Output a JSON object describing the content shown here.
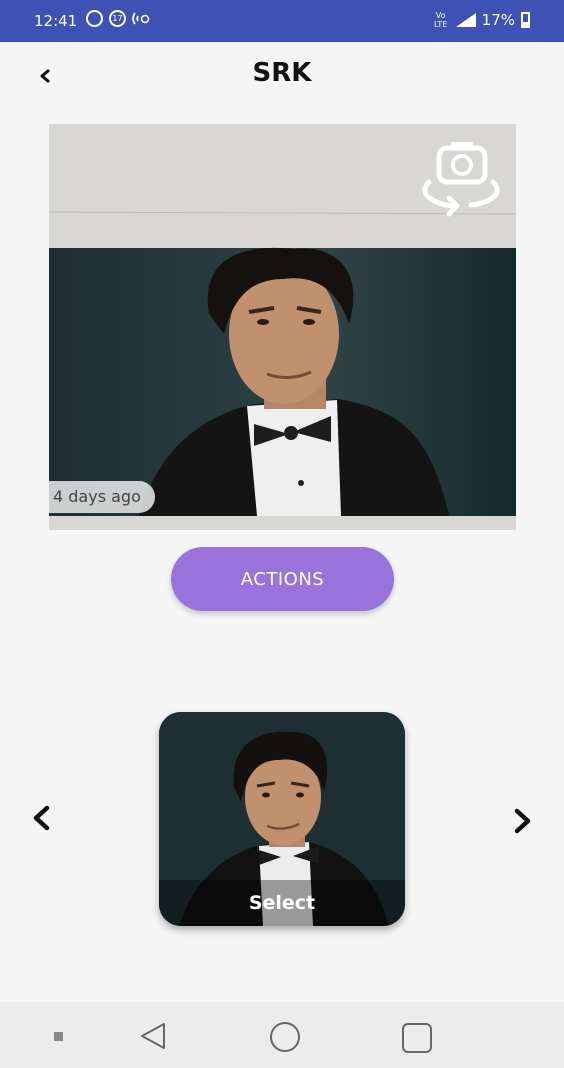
{
  "status_bar": {
    "time": "12:41",
    "network_badge": "Vo LTE",
    "battery_percent": "17%",
    "left_icons": [
      "whatsapp-icon",
      "notification-count-icon",
      "hotspot-icon"
    ],
    "notification_count": "17"
  },
  "header": {
    "title": "SRK",
    "back_icon": "chevron-left-icon"
  },
  "photo": {
    "timestamp": "4 days ago",
    "camera_icon": "switch-camera-icon"
  },
  "actions": {
    "label": "ACTIONS",
    "color": "#9a72db"
  },
  "carousel": {
    "select_label": "Select",
    "prev_icon": "chevron-left-icon",
    "next_icon": "chevron-right-icon"
  },
  "nav_bar": {
    "icons": [
      "menu-icon",
      "back-triangle-icon",
      "home-circle-icon",
      "recents-square-icon"
    ]
  },
  "colors": {
    "status_bar": "#3f51b5",
    "background": "#f5f5f5",
    "accent": "#9a72db"
  }
}
